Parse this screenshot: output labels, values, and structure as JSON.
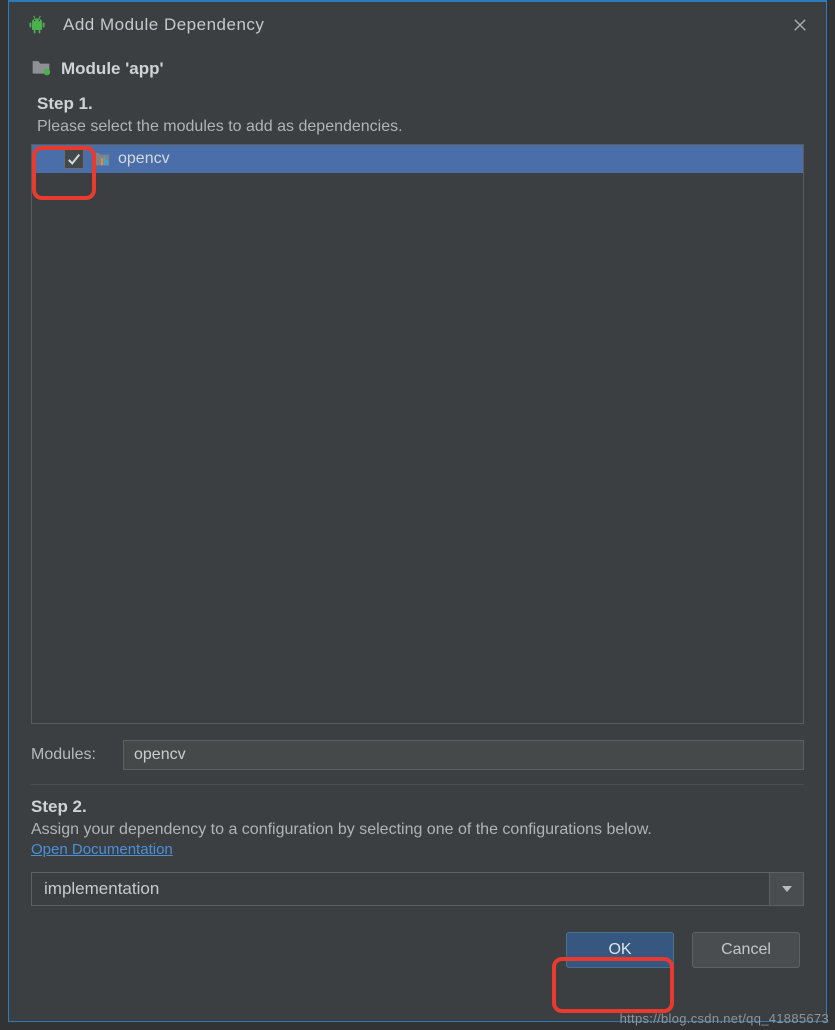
{
  "dialog": {
    "title": "Add Module Dependency"
  },
  "module": {
    "label": "Module 'app'"
  },
  "step1": {
    "title": "Step 1.",
    "desc": "Please select the modules to add as dependencies.",
    "items": [
      {
        "name": "opencv",
        "checked": true
      }
    ]
  },
  "modules_field": {
    "label": "Modules:",
    "value": "opencv"
  },
  "step2": {
    "title": "Step 2.",
    "desc": "Assign your dependency to a configuration by selecting one of the configurations below.",
    "link": "Open Documentation",
    "combo_value": "implementation"
  },
  "buttons": {
    "ok": "OK",
    "cancel": "Cancel"
  },
  "watermark": "https://blog.csdn.net/qq_41885673"
}
